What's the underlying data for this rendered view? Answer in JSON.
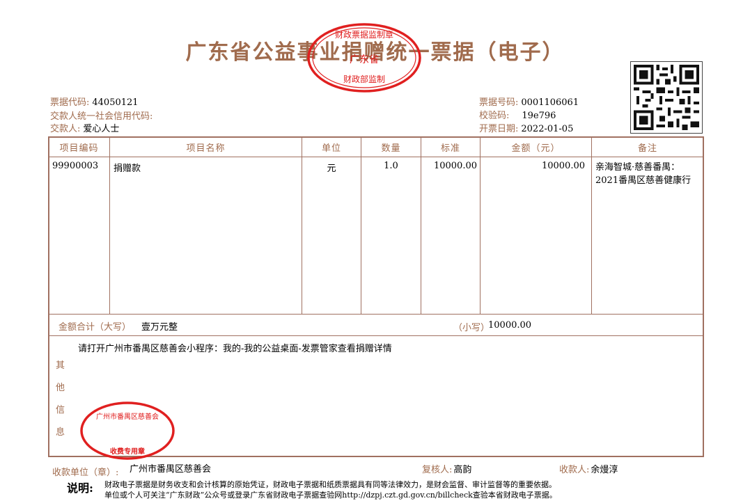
{
  "header": {
    "title": "广东省公益事业捐赠统一票据（电子）"
  },
  "meta_left": {
    "code_label": "票据代码:",
    "code_value": "44050121",
    "credit_label": "交款人统一社会信用代码:",
    "credit_value": "",
    "payer_label": "交款人:",
    "payer_value": "爱心人士"
  },
  "meta_right": {
    "number_label": "票据号码:",
    "number_value": "0001106061",
    "check_label": "校验码:",
    "check_value": "19e796",
    "date_label": "开票日期:",
    "date_value": "2022-01-05"
  },
  "table": {
    "headers": [
      "项目编码",
      "项目名称",
      "单位",
      "数量",
      "标准",
      "金额（元）",
      "备注"
    ],
    "rows": [
      {
        "code": "99900003",
        "name": "捐赠款",
        "unit": "元",
        "qty": "1.0",
        "standard": "10000.00",
        "amount": "10000.00",
        "remark": "亲海智城·慈善番禺：2021番禺区慈善健康行"
      }
    ]
  },
  "total": {
    "label": "金额合计（大写）",
    "upper": "壹万元整",
    "small_label": "（小写）",
    "small": "10000.00"
  },
  "other": {
    "label": "其他信息",
    "text": "请打开广州市番禺区慈善会小程序：我的-我的公益桌面-发票管家查看捐赠详情"
  },
  "footer": {
    "unit_label": "收款单位（章）:",
    "unit_value": "广州市番禺区慈善会",
    "reviewer_label": "复核人:",
    "reviewer_value": "高韵",
    "receiver_label": "收款人:",
    "receiver_value": "余熳淳"
  },
  "notes": {
    "label": "说明:",
    "line1": "财政电子票据是财务收支和会计核算的原始凭证，财政电子票据和纸质票据具有同等法律效力，是财会监督、审计监督等的重要依据。",
    "line2": "单位或个人可关注“广东财政”公众号或登录广东省财政电子票据查验网http://dzpj.czt.gd.gov.cn/billcheck查验本省财政电子票据。"
  },
  "stamps": {
    "top_text": "财政票据监制章 广东省 财政部监制",
    "bottom_text": "广州市番禺区慈善会 收费专用章"
  },
  "colors": {
    "accent": "#a06b4d",
    "stamp": "#e02020",
    "border": "#a07060"
  }
}
